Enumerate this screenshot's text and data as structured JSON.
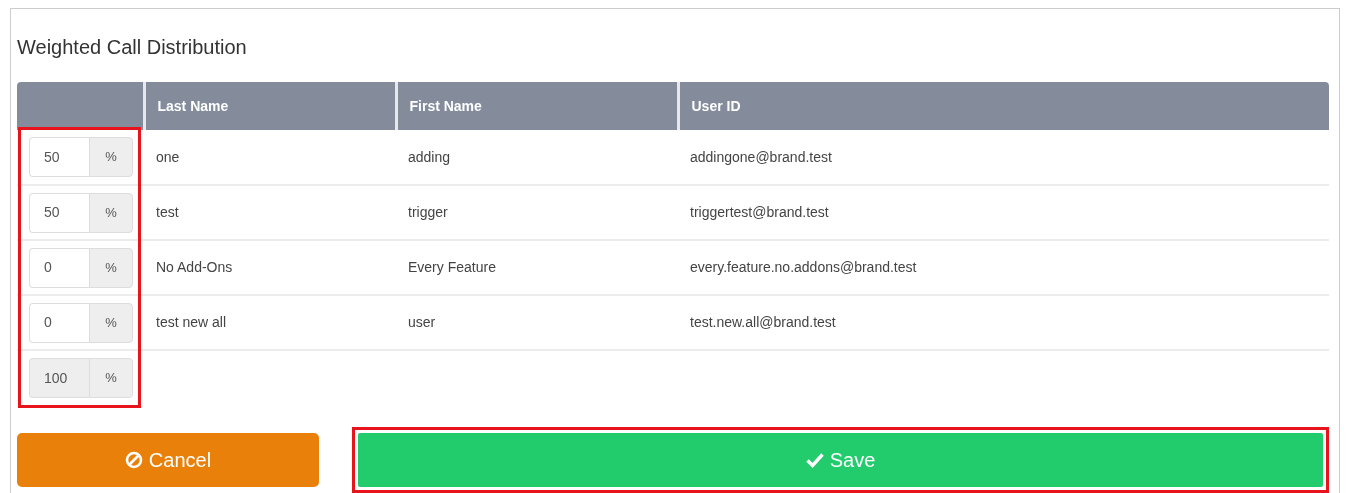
{
  "panel": {
    "title": "Weighted Call Distribution"
  },
  "table": {
    "columns": [
      "Last Name",
      "First Name",
      "User ID"
    ],
    "rows": [
      {
        "weight": "50",
        "unit": "%",
        "disabled": false,
        "cells": [
          "one",
          "adding",
          "addingone@brand.test"
        ]
      },
      {
        "weight": "50",
        "unit": "%",
        "disabled": false,
        "cells": [
          "test",
          "trigger",
          "triggertest@brand.test"
        ]
      },
      {
        "weight": "0",
        "unit": "%",
        "disabled": false,
        "cells": [
          "No Add-Ons",
          "Every Feature",
          "every.feature.no.addons@brand.test"
        ]
      },
      {
        "weight": "0",
        "unit": "%",
        "disabled": false,
        "cells": [
          "test new all",
          "user",
          "test.new.all@brand.test"
        ]
      }
    ],
    "total": {
      "weight": "100",
      "unit": "%",
      "disabled": true
    },
    "weights_highlighted": true
  },
  "buttons": [
    {
      "kind": "cancel",
      "label": "Cancel",
      "highlighted": false
    },
    {
      "kind": "save",
      "label": "Save",
      "highlighted": true
    }
  ]
}
